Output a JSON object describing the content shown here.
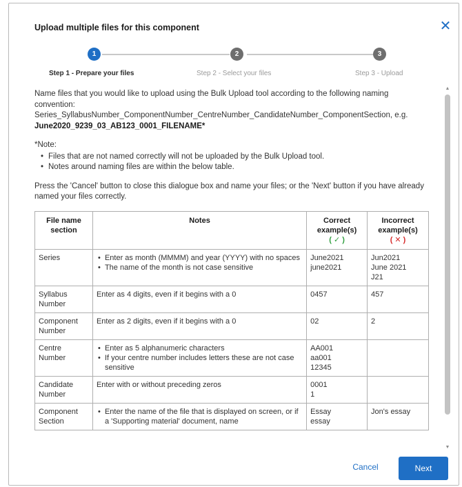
{
  "dialog": {
    "title": "Upload multiple files for this component",
    "close_icon": "close-icon"
  },
  "stepper": {
    "steps": [
      {
        "number": "1",
        "label": "Step 1 - Prepare your files",
        "active": true
      },
      {
        "number": "2",
        "label": "Step 2 - Select your files",
        "active": false
      },
      {
        "number": "3",
        "label": "Step 3 - Upload",
        "active": false
      }
    ]
  },
  "content": {
    "intro": "Name files that you would like to upload using the Bulk Upload tool according to the following naming convention:",
    "convention": "Series_SyllabusNumber_ComponentNumber_CentreNumber_CandidateNumber_ComponentSection,",
    "example_prefix": "e.g. ",
    "example": "June2020_9239_03_AB123_0001_FILENAME*",
    "note_title": "*Note:",
    "notes": [
      "Files that are not named correctly will not be uploaded by the Bulk Upload tool.",
      "Notes around naming files are within the below table."
    ],
    "instruction": "Press the 'Cancel' button to close this dialogue box and name your files; or the 'Next' button if you have already named your files correctly."
  },
  "table": {
    "headers": {
      "section": "File name section",
      "notes": "Notes",
      "correct": "Correct example(s)",
      "correct_mark": "( ✓ )",
      "incorrect": "Incorrect example(s)",
      "incorrect_mark": "( ✕ )"
    },
    "rows": [
      {
        "section": "Series",
        "notes_list": [
          "Enter as month (MMMM) and year (YYYY) with no spaces",
          "The name of the month is not case sensitive"
        ],
        "correct": [
          "June2021",
          "june2021"
        ],
        "incorrect": [
          "Jun2021",
          "June 2021",
          "J21"
        ]
      },
      {
        "section": "Syllabus Number",
        "notes_text": "Enter as 4 digits, even if it begins with a 0",
        "correct": [
          "0457"
        ],
        "incorrect": [
          "457"
        ]
      },
      {
        "section": "Component Number",
        "notes_text": "Enter as 2 digits, even if it begins with a 0",
        "correct": [
          "02"
        ],
        "incorrect": [
          "2"
        ]
      },
      {
        "section": "Centre Number",
        "notes_list": [
          "Enter as 5 alphanumeric characters",
          "If your centre number includes letters these are not case sensitive"
        ],
        "correct": [
          "AA001",
          "aa001",
          "12345"
        ],
        "incorrect": []
      },
      {
        "section": "Candidate Number",
        "notes_text": "Enter with or without preceding zeros",
        "correct": [
          "0001",
          "1"
        ],
        "incorrect": []
      },
      {
        "section": "Component Section",
        "notes_list": [
          "Enter the name of the file that is displayed on screen, or if a 'Supporting material' document, name"
        ],
        "correct": [
          "Essay",
          "essay"
        ],
        "incorrect": [
          "Jon's essay"
        ]
      }
    ]
  },
  "footer": {
    "cancel_label": "Cancel",
    "next_label": "Next"
  },
  "colors": {
    "accent": "#1f6fc5",
    "correct": "#2f9e3e",
    "incorrect": "#d62828"
  }
}
